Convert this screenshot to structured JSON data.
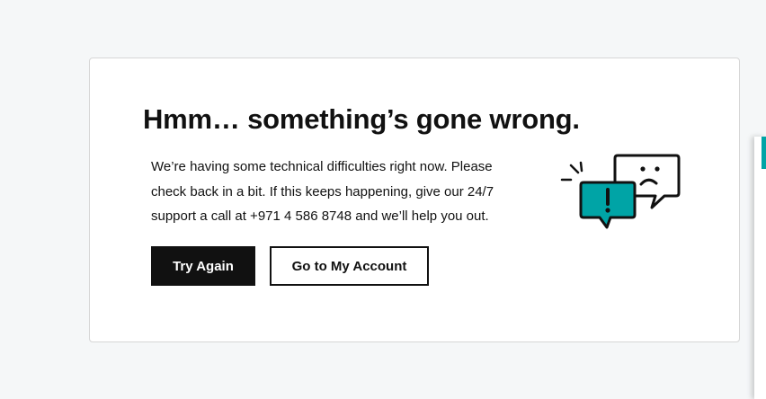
{
  "error": {
    "title": "Hmm… something’s gone wrong.",
    "message": "We’re having some technical difficulties right now. Please check back in a bit. If this keeps happening, give our 24/7 support a call at +971 4 586 8748 and we’ll help you out.",
    "illustration_icon": "chat-bubbles-error-icon"
  },
  "actions": {
    "try_again_label": "Try Again",
    "go_to_account_label": "Go to My Account"
  },
  "colors": {
    "accent": "#00a4a6",
    "primary_button": "#111111",
    "background": "#f5f7f8"
  }
}
